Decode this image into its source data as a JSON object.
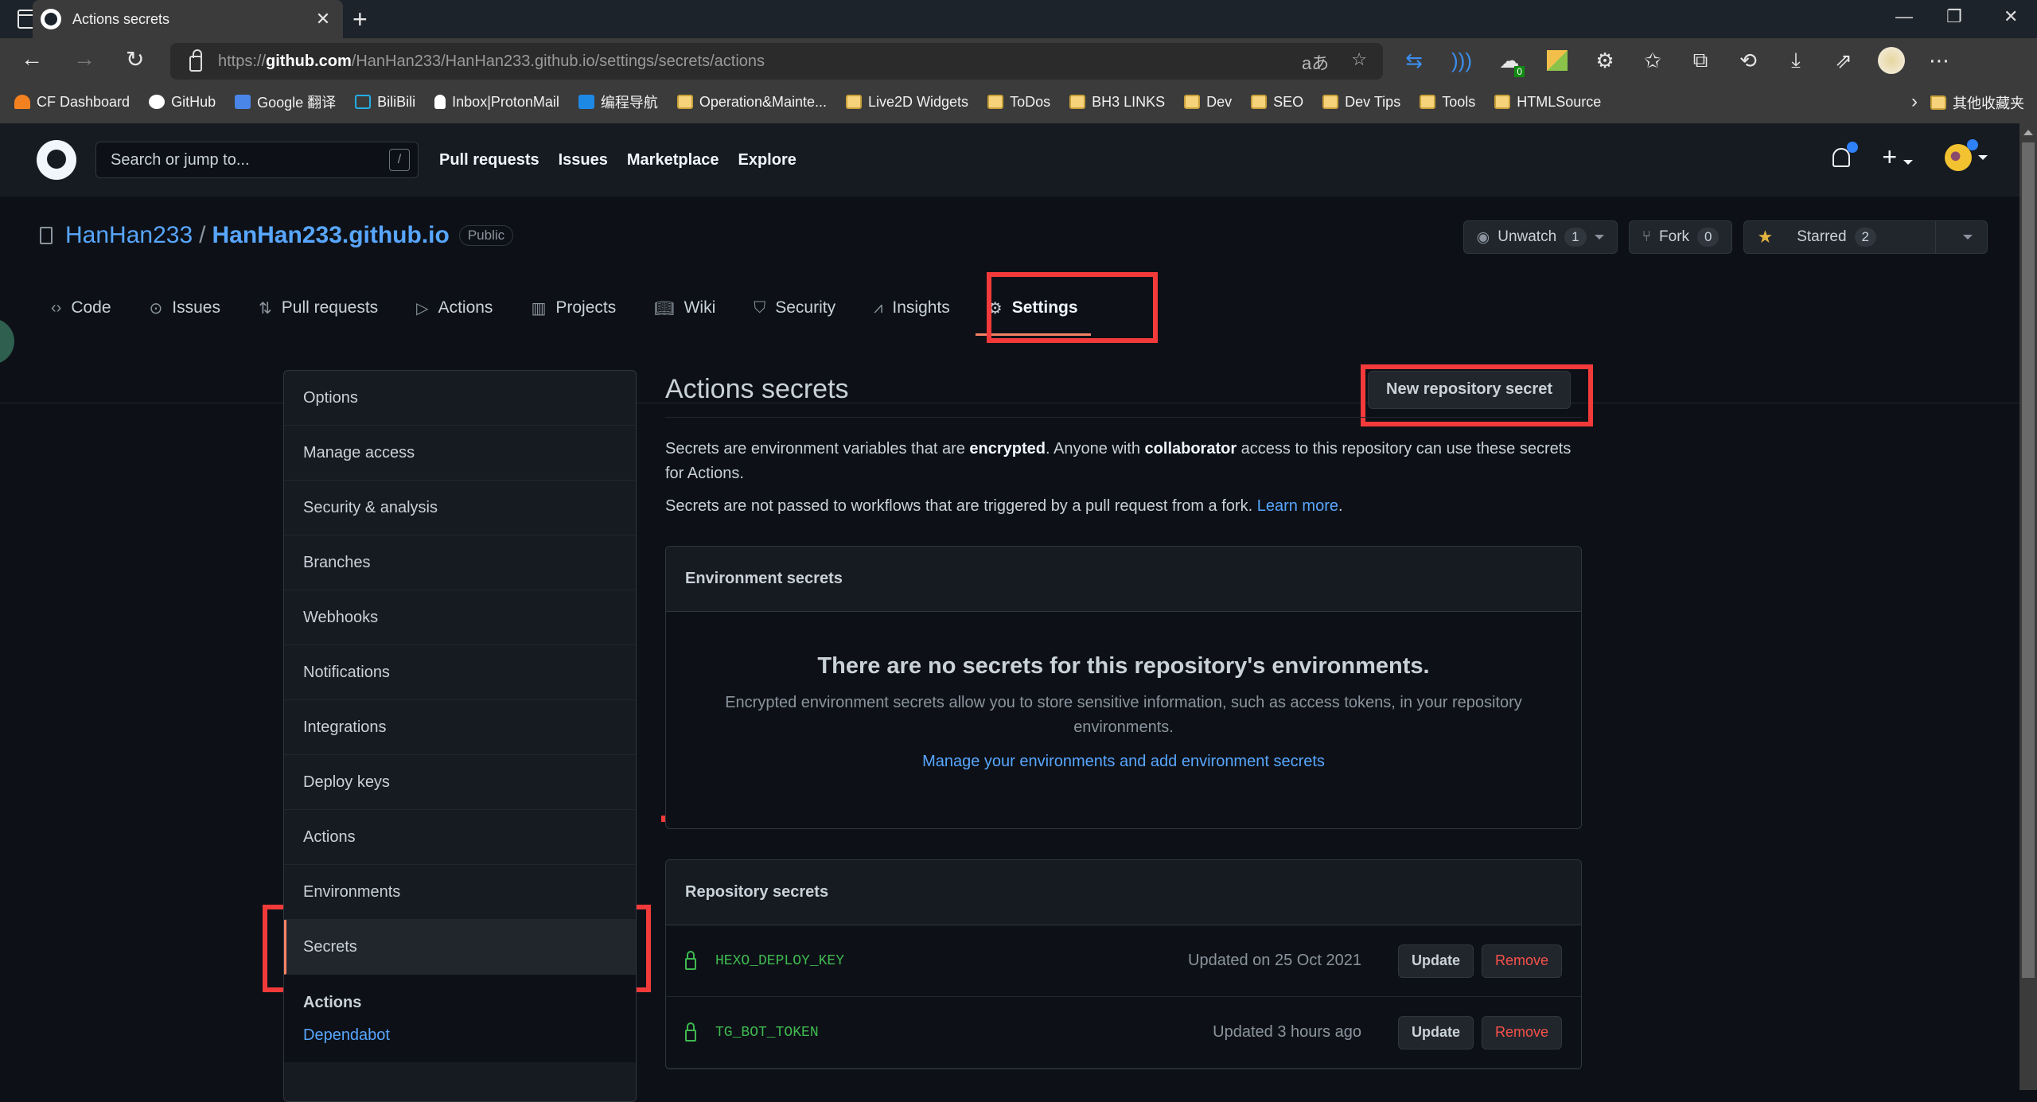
{
  "browser": {
    "tab_title": "Actions secrets",
    "url_prefix": "https://",
    "url_domain": "github.com",
    "url_path": "/HanHan233/HanHan233.github.io/settings/secrets/actions",
    "read_aloud_label": "aあ",
    "ext_badge": "0",
    "bookmarks": [
      {
        "label": "CF Dashboard",
        "icon": "cloudflare-icon"
      },
      {
        "label": "GitHub",
        "icon": "github-icon"
      },
      {
        "label": "Google 翻译",
        "icon": "google-translate-icon"
      },
      {
        "label": "BiliBili",
        "icon": "bilibili-icon"
      },
      {
        "label": "Inbox|ProtonMail",
        "icon": "protonmail-icon"
      },
      {
        "label": "编程导航",
        "icon": "code-nav-icon"
      },
      {
        "label": "Operation&Mainte...",
        "icon": "folder-icon"
      },
      {
        "label": "Live2D Widgets",
        "icon": "folder-icon"
      },
      {
        "label": "ToDos",
        "icon": "folder-icon"
      },
      {
        "label": "BH3 LINKS",
        "icon": "folder-icon"
      },
      {
        "label": "Dev",
        "icon": "folder-icon"
      },
      {
        "label": "SEO",
        "icon": "folder-icon"
      },
      {
        "label": "Dev Tips",
        "icon": "folder-icon"
      },
      {
        "label": "Tools",
        "icon": "folder-icon"
      },
      {
        "label": "HTMLSource",
        "icon": "folder-icon"
      }
    ],
    "other_bookmarks": "其他收藏夹"
  },
  "header": {
    "search_placeholder": "Search or jump to...",
    "search_key": "/",
    "nav": [
      "Pull requests",
      "Issues",
      "Marketplace",
      "Explore"
    ]
  },
  "repo": {
    "owner": "HanHan233",
    "separator": "/",
    "name": "HanHan233.github.io",
    "visibility": "Public",
    "watch_label": "Unwatch",
    "watch_count": "1",
    "fork_label": "Fork",
    "fork_count": "0",
    "star_label": "Starred",
    "star_count": "2",
    "tabs": [
      {
        "label": "Code",
        "icon": "code-icon"
      },
      {
        "label": "Issues",
        "icon": "issue-icon"
      },
      {
        "label": "Pull requests",
        "icon": "pull-request-icon"
      },
      {
        "label": "Actions",
        "icon": "play-icon"
      },
      {
        "label": "Projects",
        "icon": "project-icon"
      },
      {
        "label": "Wiki",
        "icon": "book-icon"
      },
      {
        "label": "Security",
        "icon": "shield-icon"
      },
      {
        "label": "Insights",
        "icon": "graph-icon"
      },
      {
        "label": "Settings",
        "icon": "gear-icon",
        "active": true
      }
    ]
  },
  "sidebar": {
    "items": [
      {
        "label": "Options"
      },
      {
        "label": "Manage access"
      },
      {
        "label": "Security & analysis"
      },
      {
        "label": "Branches"
      },
      {
        "label": "Webhooks"
      },
      {
        "label": "Notifications"
      },
      {
        "label": "Integrations"
      },
      {
        "label": "Deploy keys"
      },
      {
        "label": "Actions"
      },
      {
        "label": "Environments"
      },
      {
        "label": "Secrets",
        "active": true
      }
    ],
    "section_heading": "Actions",
    "section_link": "Dependabot"
  },
  "main": {
    "title": "Actions secrets",
    "new_secret_button": "New repository secret",
    "desc_1": "Secrets are environment variables that are ",
    "desc_bold_1": "encrypted",
    "desc_2": ". Anyone with ",
    "desc_bold_2": "collaborator",
    "desc_3": " access to this repository can use these secrets for Actions.",
    "desc_fork": "Secrets are not passed to workflows that are triggered by a pull request from a fork. ",
    "learn_more": "Learn more",
    "period": ".",
    "env_box": {
      "heading": "Environment secrets",
      "blank_title": "There are no secrets for this repository's environments.",
      "blank_desc": "Encrypted environment secrets allow you to store sensitive information, such as access tokens, in your repository environments.",
      "blank_link": "Manage your environments and add environment secrets"
    },
    "repo_box": {
      "heading": "Repository secrets",
      "secrets": [
        {
          "name": "HEXO_DEPLOY_KEY",
          "updated": "Updated on 25 Oct 2021",
          "update_label": "Update",
          "remove_label": "Remove"
        },
        {
          "name": "TG_BOT_TOKEN",
          "updated": "Updated 3 hours ago",
          "update_label": "Update",
          "remove_label": "Remove"
        }
      ]
    }
  },
  "colors": {
    "accent_link": "#58a6ff",
    "active_underline": "#f78166",
    "secret_green": "#3fb950",
    "danger": "#f85149",
    "highlight_box": "#f23a3a"
  }
}
